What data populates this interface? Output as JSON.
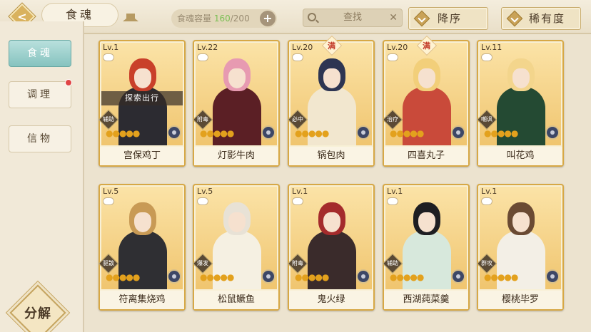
{
  "header": {
    "title": "食魂",
    "capacity_label": "食魂容量",
    "capacity_current": "160",
    "capacity_total": "/200",
    "plus_label": "+",
    "search_label": "查找",
    "clear_label": "✕",
    "sort_order_label": "降序",
    "sort_rarity_label": "稀有度"
  },
  "sidebar": {
    "tabs": [
      {
        "label": "食魂"
      },
      {
        "label": "调理"
      },
      {
        "label": "信物"
      }
    ],
    "decompose_label": "分解"
  },
  "cards": [
    {
      "level": "Lv.1",
      "name": "宫保鸡丁",
      "role": "辅助",
      "full": "",
      "overlay": "探索出行",
      "stars": "●●●●●",
      "hair": "#c9402a",
      "cloth": "#2c2b31"
    },
    {
      "level": "Lv.22",
      "name": "灯影牛肉",
      "role": "附毒",
      "full": "",
      "overlay": "",
      "stars": "●●●●●",
      "hair": "#e79ab1",
      "cloth": "#5b1f25"
    },
    {
      "level": "Lv.20",
      "name": "锅包肉",
      "role": "必中",
      "full": "满",
      "overlay": "",
      "stars": "●●●●●",
      "hair": "#2d3552",
      "cloth": "#f2e7cf"
    },
    {
      "level": "Lv.20",
      "name": "四喜丸子",
      "role": "治疗",
      "full": "满",
      "overlay": "",
      "stars": "●●●●●",
      "hair": "#f2cf7a",
      "cloth": "#c94a3a"
    },
    {
      "level": "Lv.11",
      "name": "叫花鸡",
      "role": "嘲讽",
      "full": "",
      "overlay": "",
      "stars": "●●●●●",
      "hair": "#f3d58c",
      "cloth": "#244a33"
    },
    {
      "level": "Lv.5",
      "name": "符离集烧鸡",
      "role": "驱散",
      "full": "",
      "overlay": "",
      "stars": "●●●●●",
      "hair": "#c89a55",
      "cloth": "#2f2f33"
    },
    {
      "level": "Lv.5",
      "name": "松鼠鳜鱼",
      "role": "爆发",
      "full": "",
      "overlay": "",
      "stars": "●●●●●",
      "hair": "#e8e2d6",
      "cloth": "#f5f0e2"
    },
    {
      "level": "Lv.1",
      "name": "鬼火绿",
      "role": "附毒",
      "full": "",
      "overlay": "",
      "stars": "●●●●●",
      "hair": "#a42b2c",
      "cloth": "#3a2b2b"
    },
    {
      "level": "Lv.1",
      "name": "西湖莼菜羹",
      "role": "辅助",
      "full": "",
      "overlay": "",
      "stars": "●●●●●",
      "hair": "#1e1e22",
      "cloth": "#d7e8dc"
    },
    {
      "level": "Lv.1",
      "name": "樱桃毕罗",
      "role": "群攻",
      "full": "",
      "overlay": "",
      "stars": "●●●●●",
      "hair": "#6a4a33",
      "cloth": "#f3efe6"
    }
  ],
  "colors": {
    "accent_teal": "#86c3bf",
    "card_border": "#d7a845",
    "capacity_current": "#7cbf55",
    "notification_dot": "#e04545"
  }
}
